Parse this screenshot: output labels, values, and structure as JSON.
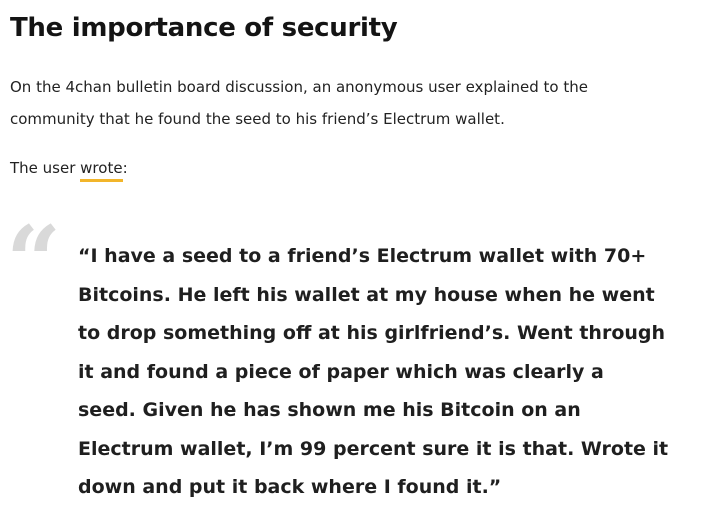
{
  "article": {
    "heading": "The importance of security",
    "intro_lines": [
      "On the 4chan bulletin board discussion, an anonymous user explained to the",
      "community that he found the seed to his friend’s Electrum wallet."
    ],
    "wrote_prefix": "The user ",
    "wrote_link": "wrote",
    "wrote_suffix": ":",
    "quote_mark": "“",
    "quote_lines": [
      "“I have a seed to a friend’s Electrum wallet with 70+",
      "Bitcoins. He left his wallet at my house when he went",
      "to drop something off at his girlfriend’s. Went through",
      "it and found a piece of paper which was clearly a",
      "seed. Given he has shown me his Bitcoin on an",
      "Electrum wallet, I’m 99 percent sure it is that. Wrote it",
      "down and put it back where I found it.”"
    ]
  },
  "colors": {
    "link_underline": "#f2b52a",
    "quote_mark": "#d9d9d9",
    "text": "#1f1f1f"
  }
}
